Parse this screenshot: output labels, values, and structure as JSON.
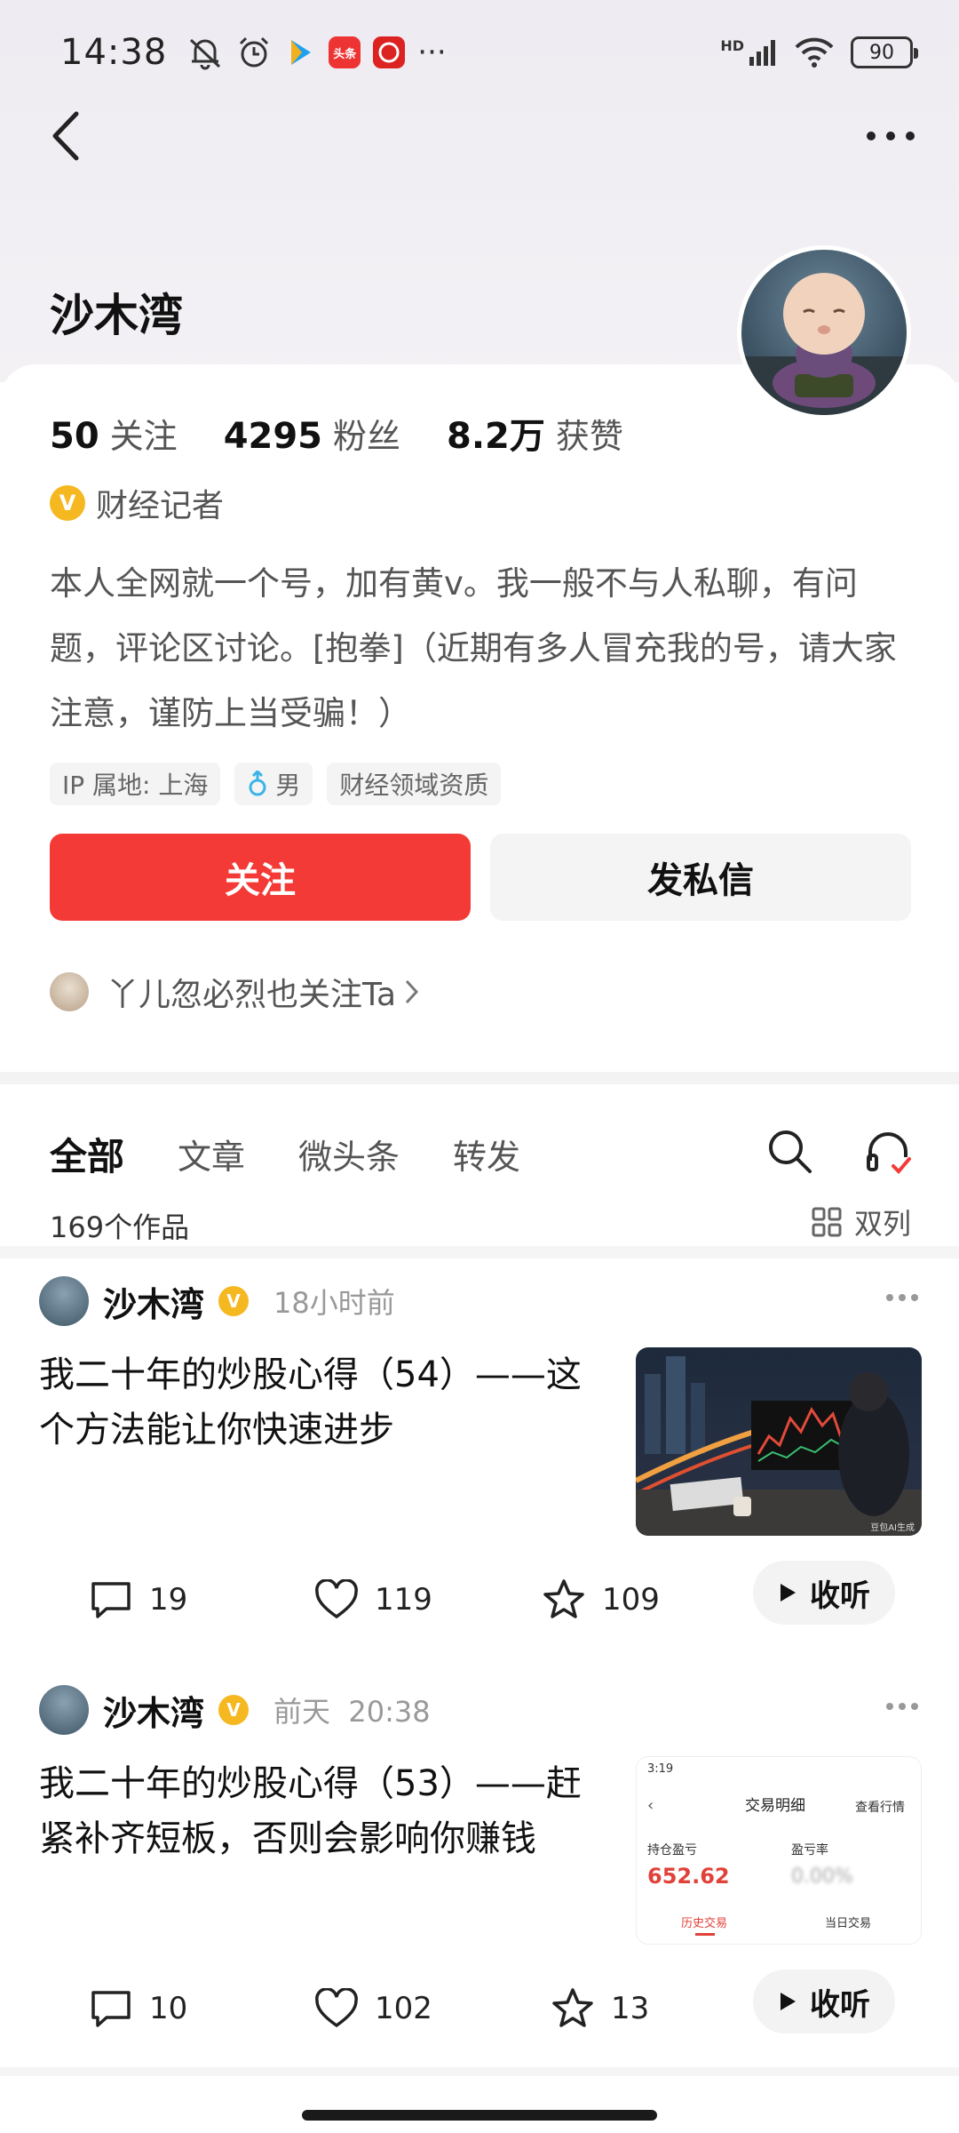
{
  "status_bar": {
    "time": "14:38",
    "icons": [
      "mute-icon",
      "alarm-icon",
      "app-icon",
      "toutiao-icon",
      "app-icon",
      "more-icon"
    ],
    "app_badge": "头条",
    "more": "···",
    "network": "HD",
    "battery": "90"
  },
  "profile": {
    "name": "沙木湾",
    "stats": [
      {
        "num": "50",
        "label": "关注"
      },
      {
        "num": "4295",
        "label": "粉丝"
      },
      {
        "num": "8.2万",
        "label": "获赞"
      }
    ],
    "verified_letter": "V",
    "verified_title": "财经记者",
    "bio": "本人全网就一个号，加有黄v。我一般不与人私聊，有问题，评论区讨论。[抱拳]（近期有多人冒充我的号，请大家注意，谨防上当受骗！）",
    "tags": [
      "IP 属地: 上海",
      "男",
      "财经领域资质"
    ],
    "follow_label": "关注",
    "message_label": "发私信",
    "mutual_text": "丫儿忽必烈也关注Ta"
  },
  "tabs": {
    "items": [
      "全部",
      "文章",
      "微头条",
      "转发"
    ],
    "active": "全部",
    "works_count": "169个作品",
    "layout_label": "双列"
  },
  "posts": [
    {
      "author": "沙木湾",
      "time": "18小时前",
      "title": "我二十年的炒股心得（54）——这个方法能让你快速进步",
      "thumb_caption": "豆包AI生成",
      "comments": "19",
      "likes": "119",
      "favorites": "109",
      "listen_label": "收听"
    },
    {
      "author": "沙木湾",
      "time": "前天  20:38",
      "title": "我二十年的炒股心得（53）——赶紧补齐短板，否则会影响你赚钱",
      "thumb": {
        "time": "3:19",
        "title": "交易明细",
        "right_link": "查看行情",
        "label1": "持仓盈亏",
        "value1": "652.62",
        "label2": "盈亏率",
        "value2": "0.00%",
        "tab1": "历史交易",
        "tab2": "当日交易"
      },
      "comments": "10",
      "likes": "102",
      "favorites": "13",
      "listen_label": "收听"
    }
  ],
  "colors": {
    "accent": "#f33a36",
    "verified": "#f5b820",
    "profit": "#e0423a"
  }
}
